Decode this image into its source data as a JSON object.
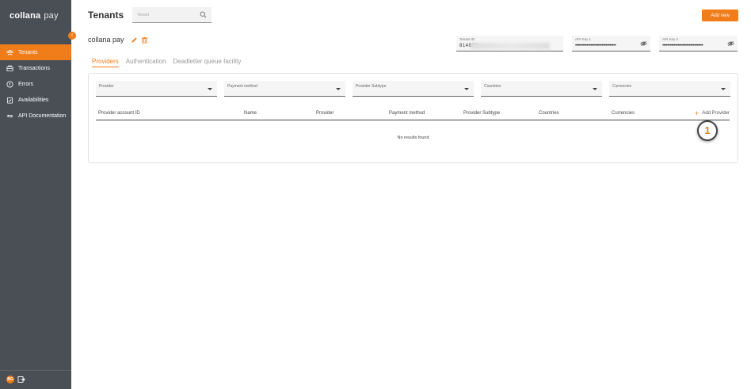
{
  "brand": {
    "name": "collana",
    "product": "pay"
  },
  "colors": {
    "accent": "#f07c1a",
    "sidebar": "#4a4f56"
  },
  "sidebar": {
    "collapse_icon": "chevron-left",
    "items": [
      {
        "label": "Tenants",
        "icon": "users-icon",
        "active": true
      },
      {
        "label": "Transactions",
        "icon": "transactions-icon",
        "active": false
      },
      {
        "label": "Errors",
        "icon": "error-icon",
        "active": false
      },
      {
        "label": "Availabilities",
        "icon": "availability-icon",
        "active": false
      },
      {
        "label": "API Documentation",
        "icon": "api-icon",
        "active": false
      }
    ],
    "footer": {
      "avatar_initials": "BG",
      "logout_icon": "logout-icon"
    }
  },
  "header": {
    "title": "Tenants",
    "search_placeholder": "Tenant",
    "add_new_label": "Add new"
  },
  "tenant": {
    "name": "collana pay",
    "tenant_id_label": "Tenant ID",
    "tenant_id_value": "81480C",
    "api_key1_label": "API Key 1",
    "api_key1_value": "••••••••••••••••••••••••••••••••",
    "api_key2_label": "API Key 2",
    "api_key2_value": "••••••••••••••••••••••••••••••••"
  },
  "tabs": [
    {
      "label": "Providers",
      "active": true
    },
    {
      "label": "Authentication",
      "active": false
    },
    {
      "label": "Deadletter queue facility",
      "active": false
    }
  ],
  "filters": [
    {
      "label": "Provider"
    },
    {
      "label": "Payment method"
    },
    {
      "label": "Provider Subtype"
    },
    {
      "label": "Countries"
    },
    {
      "label": "Currencies"
    }
  ],
  "table": {
    "columns": [
      "Provider account ID",
      "Name",
      "Provider",
      "Payment method",
      "Provider Subtype",
      "Countries",
      "Currencies"
    ],
    "add_provider_label": "Add Provider",
    "empty_text": "No results found"
  },
  "annotation": {
    "step": "1"
  }
}
